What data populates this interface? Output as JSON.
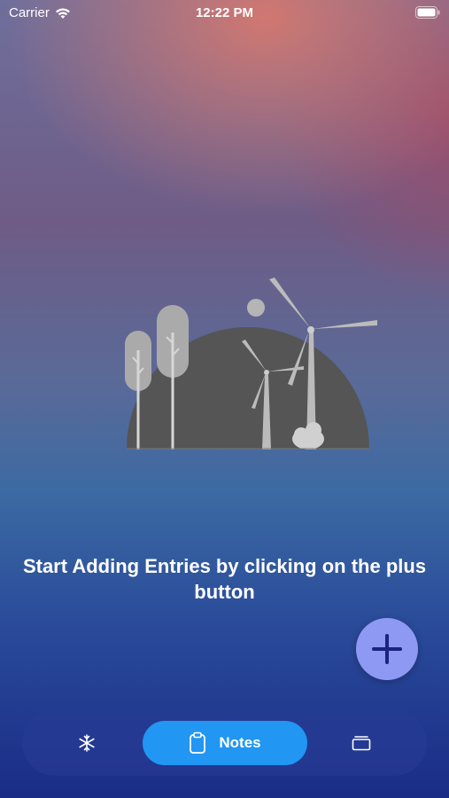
{
  "status_bar": {
    "carrier": "Carrier",
    "time": "12:22 PM"
  },
  "empty_state": {
    "message": "Start Adding Entries by clicking on the plus button"
  },
  "tab_bar": {
    "tabs": [
      {
        "icon": "snowflake-icon",
        "label": ""
      },
      {
        "icon": "clipboard-icon",
        "label": "Notes",
        "active": true
      },
      {
        "icon": "folder-icon",
        "label": ""
      }
    ]
  },
  "colors": {
    "fab": "#8e99f3",
    "active_tab": "#2196f3",
    "illustration_circle": "#555555"
  }
}
